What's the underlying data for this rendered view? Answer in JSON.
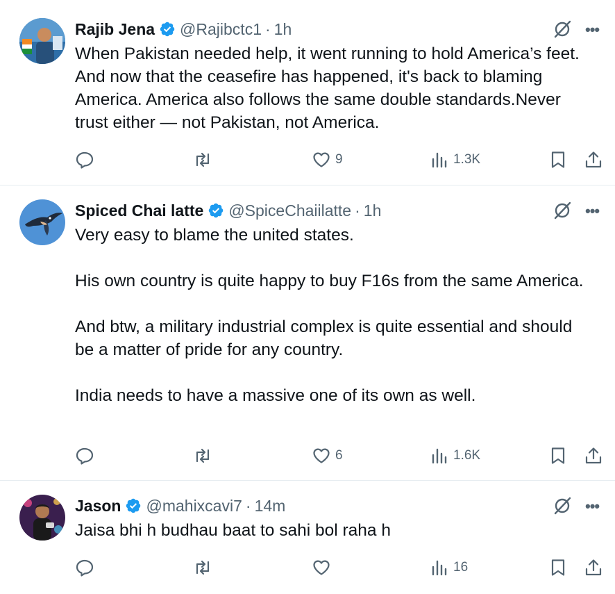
{
  "tweets": [
    {
      "name": "Rajib Jena",
      "handle": "@Rajibctc1",
      "time": "1h",
      "text": "When Pakistan needed help, it went running to hold America’s feet. And now that the ceasefire has happened, it's back to blaming America. America also follows the same double standards.Never trust either — not Pakistan, not America.",
      "likes": "9",
      "views": "1.3K"
    },
    {
      "name": "Spiced Chai latte",
      "handle": "@SpiceChaiilatte",
      "time": "1h",
      "text": "Very easy to blame the united states.\n\nHis own country is quite happy to buy F16s from the same America.\n\nAnd btw, a military industrial complex is quite essential and should be a matter of pride for any country.\n\nIndia needs to have a massive one of its own as well.",
      "likes": "6",
      "views": "1.6K"
    },
    {
      "name": "Jason",
      "handle": "@mahixcavi7",
      "time": "14m",
      "text": "Jaisa bhi h budhau baat to sahi bol raha h",
      "likes": "",
      "views": "16"
    }
  ],
  "separator": "·",
  "more_label": "•••",
  "icons": {
    "verified": "verified-badge-icon",
    "grok": "grok-icon",
    "reply": "reply-icon",
    "retweet": "retweet-icon",
    "like": "like-icon",
    "views": "views-icon",
    "bookmark": "bookmark-icon",
    "share": "share-icon"
  },
  "colors": {
    "verified": "#1d9bf0",
    "secondary_text": "#536471",
    "primary_text": "#0f1419",
    "divider": "#e6ecf0"
  }
}
